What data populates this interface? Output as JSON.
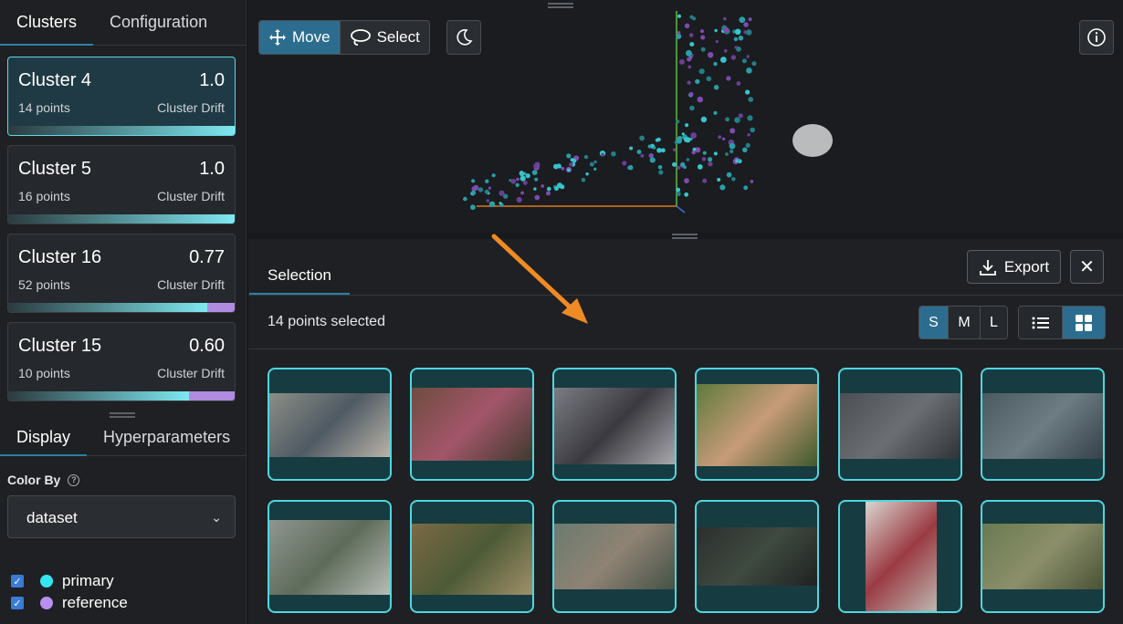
{
  "sidebar": {
    "tabs": [
      "Clusters",
      "Configuration"
    ],
    "clusters": [
      {
        "name": "Cluster 4",
        "value": "1.0",
        "points": "14 points",
        "metric": "Cluster Drift",
        "drift_primary": 1.0,
        "selected": true
      },
      {
        "name": "Cluster 5",
        "value": "1.0",
        "points": "16 points",
        "metric": "Cluster Drift",
        "drift_primary": 1.0,
        "selected": false
      },
      {
        "name": "Cluster 16",
        "value": "0.77",
        "points": "52 points",
        "metric": "Cluster Drift",
        "drift_primary": 0.88,
        "selected": false
      },
      {
        "name": "Cluster 15",
        "value": "0.60",
        "points": "10 points",
        "metric": "Cluster Drift",
        "drift_primary": 0.8,
        "selected": false
      }
    ],
    "display_tabs": [
      "Display",
      "Hyperparameters"
    ],
    "color_by_label": "Color By",
    "color_by_value": "dataset",
    "legend": [
      {
        "label": "primary",
        "color": "#33e6f2",
        "checked": true
      },
      {
        "label": "reference",
        "color": "#b98ff0",
        "checked": true
      }
    ]
  },
  "toolbar": {
    "move_label": "Move",
    "select_label": "Select",
    "icons": [
      "move-icon",
      "lasso-icon",
      "moon-icon",
      "info-icon"
    ]
  },
  "selection": {
    "tab_label": "Selection",
    "export_label": "Export",
    "count_text": "14 points selected",
    "sizes": [
      "S",
      "M",
      "L"
    ],
    "active_size": "S",
    "active_view": "grid",
    "thumbnails": [
      {
        "alt": "kids-vr-photo",
        "tone": [
          "#8b8e87",
          "#4f5a63",
          "#b9b3a8"
        ]
      },
      {
        "alt": "woman-phone-photo",
        "tone": [
          "#6f4c3f",
          "#a3566a",
          "#3e3a2e"
        ]
      },
      {
        "alt": "object-closeup-photo",
        "tone": [
          "#7b7d84",
          "#3b3a40",
          "#a9a8ad"
        ]
      },
      {
        "alt": "hug-photo",
        "tone": [
          "#5f7a3c",
          "#c79b78",
          "#3f5a2c"
        ]
      },
      {
        "alt": "crowd-photo",
        "tone": [
          "#4b4e52",
          "#6b6f74",
          "#2f3236"
        ]
      },
      {
        "alt": "people-outdoor-photo",
        "tone": [
          "#4a5a5f",
          "#6d7c83",
          "#36414a"
        ]
      },
      {
        "alt": "runner-photo",
        "tone": [
          "#8f9690",
          "#5e6b5a",
          "#b8bdb6"
        ]
      },
      {
        "alt": "man-phone-photo",
        "tone": [
          "#7b6a45",
          "#4d5a36",
          "#a0906a"
        ]
      },
      {
        "alt": "child-photo",
        "tone": [
          "#6c7a6f",
          "#8e8374",
          "#455146"
        ]
      },
      {
        "alt": "dark-scene-photo",
        "tone": [
          "#2c2f2d",
          "#3f4a40",
          "#1f2220"
        ]
      },
      {
        "alt": "woman-red-photo",
        "tone": [
          "#d9d5cf",
          "#9b3b43",
          "#bdb9b2"
        ]
      },
      {
        "alt": "bike-forest-photo",
        "tone": [
          "#6a7a4f",
          "#8b8f6a",
          "#4a5236"
        ]
      }
    ]
  }
}
